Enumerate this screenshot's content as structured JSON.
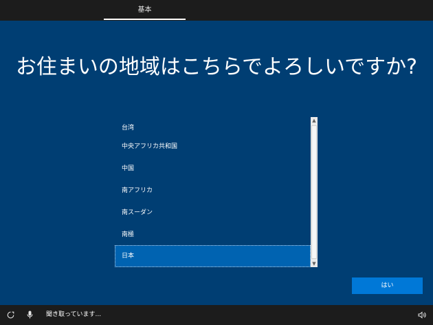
{
  "header": {
    "tab_label": "基本"
  },
  "page": {
    "title": "お住まいの地域はこちらでよろしいですか?"
  },
  "region_list": {
    "items": [
      {
        "label": "台湾"
      },
      {
        "label": "中央アフリカ共和国"
      },
      {
        "label": "中国"
      },
      {
        "label": "南アフリカ"
      },
      {
        "label": "南スーダン"
      },
      {
        "label": "南極"
      },
      {
        "label": "日本"
      }
    ],
    "selected": "日本"
  },
  "buttons": {
    "yes_label": "はい"
  },
  "footer": {
    "status_text": "聞き取っています...",
    "ease_of_access_icon": "ease-of-access-icon",
    "microphone_icon": "microphone-icon",
    "volume_icon": "volume-icon"
  },
  "colors": {
    "background": "#003e73",
    "selection": "#0063b1",
    "accent_button": "#0078d7",
    "bars": "#1c1c1c"
  }
}
